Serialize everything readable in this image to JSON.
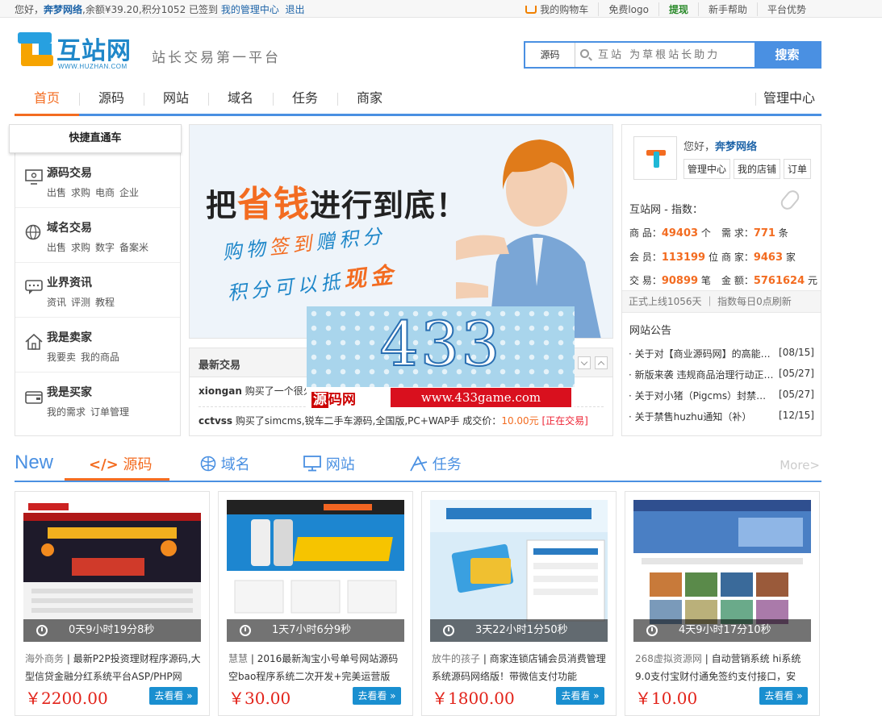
{
  "topbar": {
    "greeting": "您好，",
    "username": "奔梦网络",
    "balance": ",余额¥39.20",
    "points": ",积分1052",
    "signed": "已签到",
    "manage": "我的管理中心",
    "logout": "退出",
    "cart": "我的购物车",
    "free_logo": "免费logo",
    "withdraw": "提现",
    "help": "新手帮助",
    "advantage": "平台优势"
  },
  "header": {
    "logo_text": "互站网",
    "logo_url": "WWW.HUZHAN.COM",
    "slogan": "站长交易第一平台",
    "search_category": "源码",
    "search_placeholder": "互站 为草根站长助力",
    "search_button": "搜索"
  },
  "nav": {
    "items": [
      "首页",
      "源码",
      "网站",
      "域名",
      "任务",
      "商家"
    ],
    "manage": "管理中心"
  },
  "quick": {
    "title": "快捷直通车",
    "rows": [
      {
        "title": "源码交易",
        "links": [
          "出售",
          "求购",
          "电商",
          "企业"
        ]
      },
      {
        "title": "域名交易",
        "links": [
          "出售",
          "求购",
          "数字",
          "备案米"
        ]
      },
      {
        "title": "业界资讯",
        "links": [
          "资讯",
          "评测",
          "教程"
        ]
      },
      {
        "title": "我是卖家",
        "links": [
          "我要卖",
          "我的商品"
        ]
      },
      {
        "title": "我是买家",
        "links": [
          "我的需求",
          "订单管理"
        ]
      }
    ]
  },
  "banner": {
    "line1a": "把",
    "line1b": "省钱",
    "line1c": "进行到底！",
    "line2a": "购物",
    "line2b": "签到",
    "line2c": "赠",
    "line2d": "积分",
    "line3a": "积分可以抵",
    "line3b": "现金"
  },
  "trades": {
    "title": "最新交易",
    "items": [
      {
        "user": "xiongan",
        "text": "购买了一个很火"
      },
      {
        "user": "cctvss",
        "text": "购买了simcms,锐车二手车源码,全国版,PC+WAP手 成交价：",
        "price": "10.00元",
        "status": "[正在交易]"
      }
    ]
  },
  "ad": {
    "number": "433",
    "logo_a": "源",
    "logo_b": "码网",
    "url": "www.433game.com"
  },
  "user": {
    "hello": "您好，",
    "name": "奔梦网络",
    "buttons": [
      "管理中心",
      "我的店铺",
      "订单"
    ],
    "index_title": "互站网 - 指数：",
    "stats": [
      {
        "label": "商 品：",
        "value": "49403",
        "unit": "个"
      },
      {
        "label": "需 求：",
        "value": "771",
        "unit": "条"
      },
      {
        "label": "会 员：",
        "value": "113199",
        "unit": "位"
      },
      {
        "label": "商 家：",
        "value": "9463",
        "unit": "家"
      },
      {
        "label": "交 易：",
        "value": "90899",
        "unit": "笔"
      },
      {
        "label": "金 额：",
        "value": "5761624",
        "unit": "元"
      }
    ],
    "online": "正式上线1056天 ｜ 指数每日0点刷新",
    "notice_title": "网站公告",
    "notices": [
      {
        "title": "· 关于对【商业源码网】的高能预警",
        "date": "[08/15]"
      },
      {
        "title": "· 新版来袭 违规商品治理行动正式启动",
        "date": "[05/27]"
      },
      {
        "title": "· 关于对小猪（Pigcms）封禁的公告",
        "date": "[05/27]"
      },
      {
        "title": "· 关于禁售huzhu通知（补）",
        "date": "[12/15]"
      }
    ]
  },
  "tabs": {
    "new": "New",
    "items": [
      {
        "icon": "code-icon",
        "label": "源码"
      },
      {
        "icon": "globe-icon",
        "label": "域名"
      },
      {
        "icon": "monitor-icon",
        "label": "网站"
      },
      {
        "icon": "tools-icon",
        "label": "任务"
      }
    ],
    "more": "More>"
  },
  "products": [
    {
      "timer": "0天9小时19分8秒",
      "seller": "海外商务",
      "title": "最新P2P投资理财程序源码,大型信贷金融分红系统平台ASP/PHP网",
      "price": "￥2200.00",
      "go": "去看看 »"
    },
    {
      "timer": "1天7小时6分9秒",
      "seller": "慧慧",
      "title": "2016最新淘宝小号单号网站源码空bao程序系统二次开发+完美运营版",
      "price": "￥30.00",
      "go": "去看看 »"
    },
    {
      "timer": "3天22小时1分50秒",
      "seller": "放牛的孩子",
      "title": "商家连锁店铺会员消费管理系统源码网络版！带微信支付功能",
      "price": "￥1800.00",
      "go": "去看看 »"
    },
    {
      "timer": "4天9小时17分10秒",
      "seller": "268虚拟资源网",
      "title": "自动营销系统 hi系统9.0支付宝财付通免签约支付接口，安",
      "price": "￥10.00",
      "go": "去看看 »"
    }
  ],
  "colors": {
    "brand": "#4a90e2",
    "accent": "#f36c21",
    "price": "#e2231a"
  }
}
